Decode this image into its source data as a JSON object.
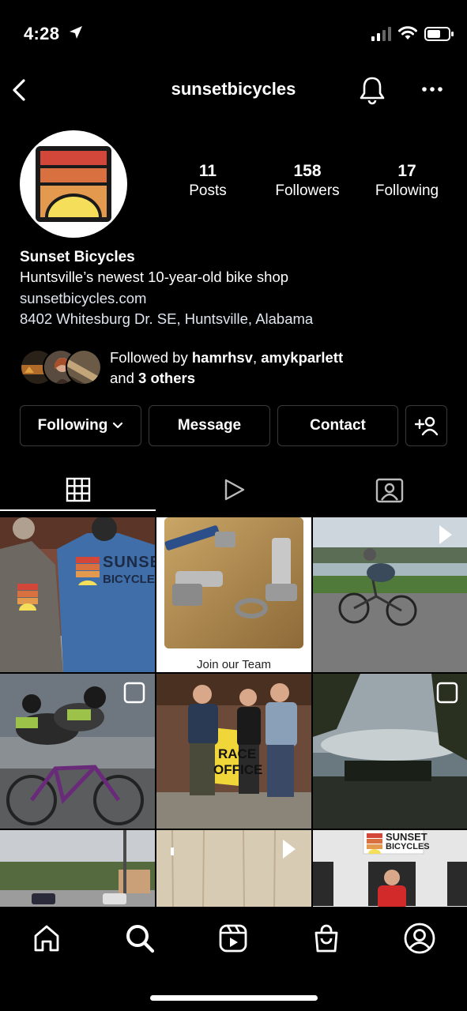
{
  "status_bar": {
    "time": "4:28"
  },
  "header": {
    "username": "sunsetbicycles"
  },
  "profile": {
    "stats": [
      {
        "value": "11",
        "label": "Posts"
      },
      {
        "value": "158",
        "label": "Followers"
      },
      {
        "value": "17",
        "label": "Following"
      }
    ],
    "name": "Sunset Bicycles",
    "bio": "Huntsville’s newest 10-year-old bike shop",
    "website": "sunsetbicycles.com",
    "address": "8402 Whitesburg Dr. SE, Huntsville, Alabama",
    "followed_by": {
      "prefix": "Followed by ",
      "user1": "hamrhsv",
      "separator": ", ",
      "user2": "amykparlett",
      "and": "and ",
      "others": "3 others"
    }
  },
  "actions": {
    "following": "Following",
    "message": "Message",
    "contact": "Contact"
  },
  "grid": {
    "cells": [
      {
        "caption": "",
        "tshirt_text": "SUNSET",
        "tshirt_text2": "BICYCLES"
      },
      {
        "caption": "Join our Team"
      },
      {
        "caption": ""
      },
      {
        "caption": ""
      },
      {
        "caption": "",
        "sign": "RACE",
        "sign2": "OFFICE"
      },
      {
        "caption": ""
      },
      {
        "caption": ""
      },
      {
        "caption": ""
      },
      {
        "caption": "",
        "sign": "SUNSET",
        "sign2": "BICYCLES"
      }
    ]
  },
  "colors": {
    "logo_red": "#d2473a",
    "logo_orange": "#d97040",
    "logo_tan": "#e39a4f",
    "logo_yellow": "#f5de5a",
    "link": "#dfe6f0"
  },
  "icons": {
    "back": "chevron-left-icon",
    "bell": "bell-icon",
    "more": "more-dots-icon",
    "grid": "grid-icon",
    "reels": "reels-icon",
    "tagged": "tagged-icon",
    "home": "home-icon",
    "search": "search-icon",
    "reels_nav": "reels-nav-icon",
    "shop": "shop-icon",
    "profile": "profile-icon"
  }
}
